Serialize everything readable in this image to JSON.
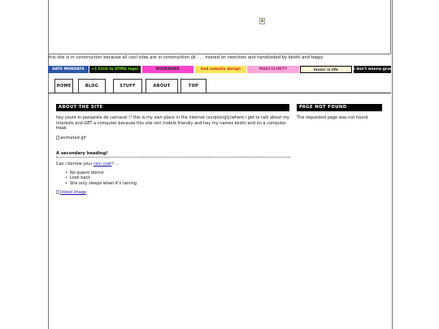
{
  "tagline": "this site is in construction because all cool sites are in construction /jk . . . hosted on neocities and handcoded by keishi and teppy",
  "buttons": [
    {
      "label": "HATE MONDAYS",
      "bg": "#2b56a8",
      "fg": "#ffffff"
    },
    {
      "label": "+1 Click to DTMG tags!",
      "bg": "#111111",
      "fg": "#7CFC00"
    },
    {
      "label": "BOOKMARK",
      "bg": "#ff44cc",
      "fg": "#222222"
    },
    {
      "label": "bad website design",
      "bg": "#ffe45a",
      "fg": "#cc2200"
    },
    {
      "label": "MASCULINITY",
      "bg": "#f7a8d8",
      "fg": "#9b1c6b"
    },
    {
      "label": "music is life",
      "bg": "#fff7d6",
      "fg": "#222222"
    },
    {
      "label": "i don't wanna grow",
      "bg": "#111111",
      "fg": "#ffffff"
    }
  ],
  "tabs": [
    "HOME",
    "BLOG",
    "STUFF",
    "ABOUT",
    "TOP"
  ],
  "main": {
    "title": "ABOUT THE SITE",
    "intro": "hey youre in passarela de carnaval !! this is my own place in the internet (surpisingly)where i get to talk about my interests and GET a computer because this site isnt mobile friendly and hey my names keishi and im a computer freak",
    "gif_alt": "animated gif",
    "heading2": "A secondary heading!",
    "borrow_prefix": "Can I borrow your",
    "borrow_link": "rain coat",
    "borrow_suffix": "? ...",
    "list": [
      "No quiero dormir",
      "Look back",
      "She only sleeps when it's raining"
    ],
    "linked_image_alt": "linked image"
  },
  "side": {
    "title": "PAGE NOT FOUND",
    "text": "The requested page was not found."
  }
}
